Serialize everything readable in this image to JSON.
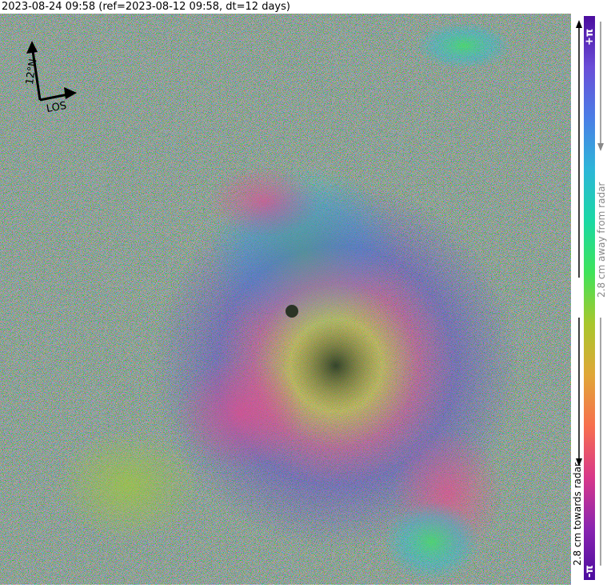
{
  "header": {
    "title": "2023-08-24 09:58 (ref=2023-08-12 09:58, dt=12 days)"
  },
  "map": {
    "heading_label": "12°N",
    "los_label": "LOS"
  },
  "colorbar": {
    "top_label": "+π",
    "bottom_label": "-π",
    "away_label": "2.8 cm away from radar",
    "towards_label": "2.8 cm towards radar",
    "colors": [
      "#4b0c9e",
      "#8a24b0",
      "#d8388a",
      "#f76f4e",
      "#e0a737",
      "#a8c72c",
      "#3fe35a",
      "#1bd8a4",
      "#2cb6d8",
      "#4a7ee6",
      "#6a4ed8",
      "#4b0c9e"
    ]
  }
}
